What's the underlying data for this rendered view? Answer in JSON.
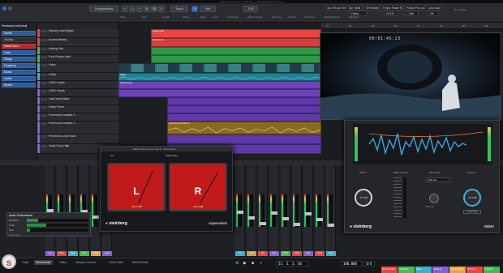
{
  "window": {
    "title": "Cubase Pro Project – Dark Sky — Ep6-Master-EX-Mixing 1"
  },
  "toolbar": {
    "configurations": "Configurations",
    "mode": "Touch",
    "grid": "Grid",
    "quantize": "1/16",
    "fields": [
      "Start",
      "End",
      "Length",
      "Offset",
      "Mute",
      "Lock",
      "Transpose",
      "Global Transp.",
      "Root Key",
      "Volume",
      "Fine Tune",
      "Musical Mode",
      "Algorithm"
    ],
    "algo_value": "Follow",
    "right_tabs": [
      "Adv. Record Time",
      "Bar / Beat",
      "Set Marker",
      "Project Frame Rate",
      "Project Pan Law",
      "Auto Save"
    ],
    "right_values": [
      "23.976",
      "-3dB",
      "Off"
    ],
    "record_label": "Rec. Mode"
  },
  "inspector": {
    "track": "Prechorus Lead Vocal",
    "items": [
      {
        "label": "Inserts",
        "style": "blue"
      },
      {
        "label": "Visibility",
        "style": "plain"
      },
      {
        "label": "Master Bus A",
        "style": "red"
      },
      {
        "label": "Vocal",
        "style": "blue"
      },
      {
        "label": "Strings",
        "style": "blue"
      },
      {
        "label": "Frequency",
        "style": "blue"
      },
      {
        "label": "Drums",
        "style": "blue"
      },
      {
        "label": "Limiter",
        "style": "blue"
      },
      {
        "label": "Reverb",
        "style": "blue"
      }
    ],
    "lower": [
      "Chords",
      "Editor",
      "Notepad",
      "Quick Controls",
      "Device Panel"
    ]
  },
  "tracks": [
    {
      "name": "Spacey Lead Higher",
      "color": "#e84545"
    },
    {
      "name": "Accent Melody",
      "color": "#e84545"
    },
    {
      "name": "Arating Pad",
      "color": "#44bb55"
    },
    {
      "name": "Post Chorus Lead",
      "color": "#44bb55"
    },
    {
      "name": "Video",
      "color": "#3bb0c9"
    },
    {
      "name": "Guitar",
      "color": "#3bb0c9"
    },
    {
      "name": "LEAD Vocals",
      "color": "#8a5fd6"
    },
    {
      "name": "LEAD Vocals",
      "color": "#8a5fd6"
    },
    {
      "name": "Lead Vocal Bass",
      "color": "#8a5fd6"
    },
    {
      "name": "Delay Throw",
      "color": "#8a5fd6"
    },
    {
      "name": "Prechorus Doubled V...",
      "color": "#8a5fd6"
    },
    {
      "name": "Prechorus Doubled V...",
      "color": "#8a5fd6"
    },
    {
      "name": "Prechorus Lead Vocal",
      "color": "#8a5fd6"
    },
    {
      "name": "Vocal Chop High",
      "color": "#8a5fd6"
    }
  ],
  "ruler": [
    "5",
    "9",
    "13",
    "17",
    "21",
    "25",
    "29",
    "33",
    "37",
    "41",
    "45",
    "49",
    "53",
    "57",
    "61",
    "65",
    "69"
  ],
  "clips": [
    {
      "label": "Spacey Pad",
      "track": 0,
      "color": "#e84545"
    },
    {
      "label": "Padchor Ch",
      "track": 1,
      "color": "#e84545"
    },
    {
      "label": "Guitar",
      "track": 5,
      "color": "#3bb0c9"
    },
    {
      "label": "LEAD Vocals",
      "track": 6,
      "color": "#8a5fd6"
    },
    {
      "label": "Prechorus Doubled Vo",
      "track": 10,
      "color": "#c9a63b"
    }
  ],
  "video": {
    "timecode": "00:01:45:23"
  },
  "supervision": {
    "title": "Master Bus Inserts: Slot 8 - SuperVision",
    "header_left": "VU",
    "header_right": "Stereo Bus",
    "left_letter": "L",
    "right_letter": "R",
    "left_readout": "-12.17 dB",
    "right_readout": "-11.61 dB",
    "brand": "steinberg",
    "product": "supervision"
  },
  "raiser": {
    "brand": "steinberg",
    "product": "raiser",
    "labels": [
      "INPUT",
      "REDUCTION",
      "RELEASE",
      "OUTPUT"
    ],
    "release_mode": "Manual",
    "input_value": "-6.2 dB",
    "output_value": "-11.6 dB",
    "release_value": "100 ms",
    "compare": "COMPARE"
  },
  "perf": {
    "title": "Audio Performance",
    "rows": [
      "Realtime",
      "Peak",
      "Disk"
    ],
    "fills": [
      0.18,
      0.32,
      0.05
    ],
    "footer": "Disk Cache"
  },
  "mixer_channels": [
    {
      "label": "Vox",
      "color": "#8a5fd6"
    },
    {
      "label": "Drum",
      "color": "#e84545"
    },
    {
      "label": "Bass",
      "color": "#3bb0c9"
    },
    {
      "label": "Gtr",
      "color": "#44bb55"
    },
    {
      "label": "Pad",
      "color": "#e8a545"
    },
    {
      "label": "Lead",
      "color": "#8a5fd6"
    },
    {
      "label": "FX",
      "color": "#3bb0c9"
    },
    {
      "label": "Verb",
      "color": "#c9a63b"
    },
    {
      "label": "Dly",
      "color": "#e84545"
    },
    {
      "label": "Bus",
      "color": "#8a5fd6"
    },
    {
      "label": "Vox2",
      "color": "#44bb55"
    },
    {
      "label": "Chop",
      "color": "#e84545"
    }
  ],
  "bottom": {
    "tabs": [
      "Track",
      "MixConsole",
      "Editor",
      "Sampler Control",
      "Chord Pads",
      "MIDI Remote"
    ],
    "active_tab": 1,
    "position": "53. 3. 3. 64",
    "tempo": "108.000",
    "signature": "4/4",
    "right_labels": [
      "Drums Parallel",
      "Harmonies",
      "Master",
      "Vocals A1",
      "Drums Parallel",
      "All Drums",
      "Vocals All"
    ]
  },
  "colors": {
    "accent": "#e84545",
    "blue": "#2c5c9c",
    "green": "#44bb55",
    "purple": "#8a5fd6",
    "cyan": "#3bb0c9"
  }
}
